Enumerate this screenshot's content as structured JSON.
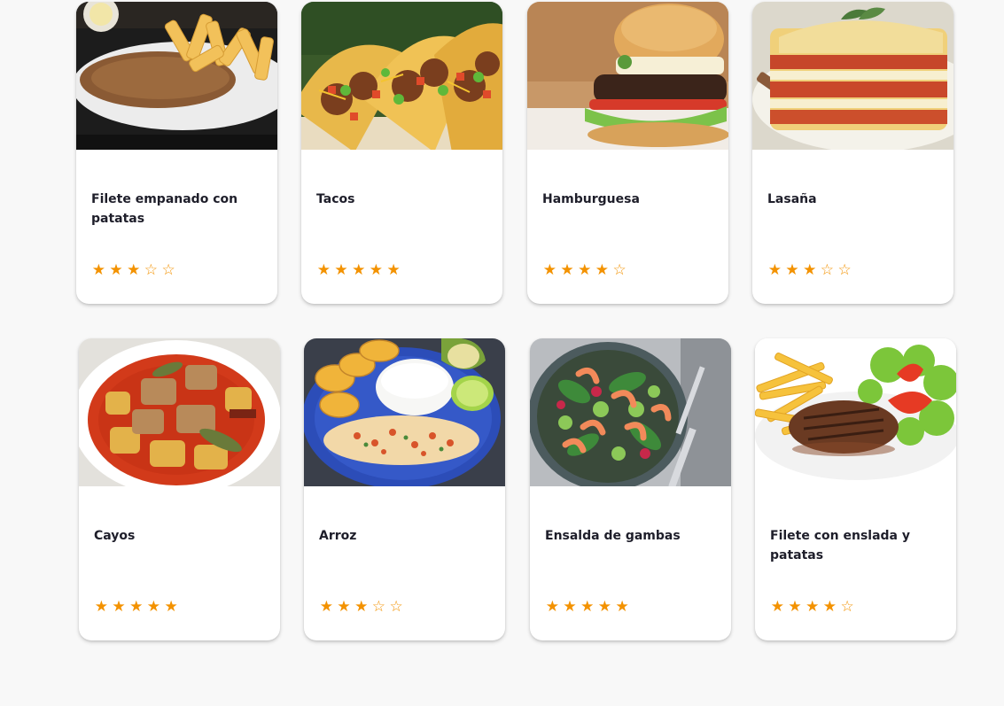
{
  "accent_color": "#f39200",
  "recipes": [
    {
      "title": "Filete empanado con patatas",
      "image": "breaded-steak-with-fries",
      "rating": 3,
      "max_rating": 5
    },
    {
      "title": "Tacos",
      "image": "tacos",
      "rating": 5,
      "max_rating": 5
    },
    {
      "title": "Hamburguesa",
      "image": "hamburger",
      "rating": 4,
      "max_rating": 5
    },
    {
      "title": "Lasaña",
      "image": "lasagna",
      "rating": 3,
      "max_rating": 5
    },
    {
      "title": "Cayos",
      "image": "stew",
      "rating": 5,
      "max_rating": 5
    },
    {
      "title": "Arroz",
      "image": "rice-with-plantains",
      "rating": 3,
      "max_rating": 5
    },
    {
      "title": "Ensalda de gambas",
      "image": "shrimp-salad",
      "rating": 5,
      "max_rating": 5
    },
    {
      "title": "Filete con enslada y patatas",
      "image": "steak-salad-fries",
      "rating": 4,
      "max_rating": 5
    }
  ]
}
